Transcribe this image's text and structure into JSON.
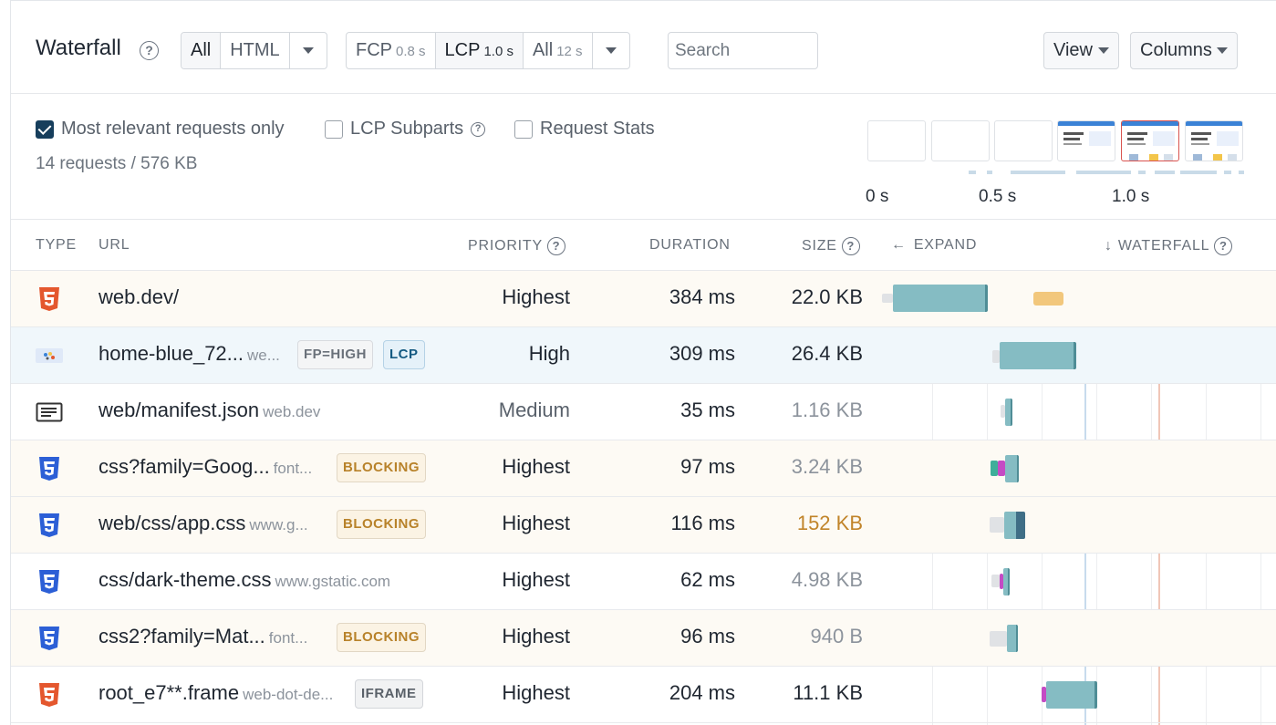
{
  "header": {
    "title": "Waterfall",
    "help_icon": "question-circle-icon",
    "filter_type": [
      {
        "label": "All",
        "active": true
      },
      {
        "label": "HTML",
        "active": false
      }
    ],
    "filter_time": [
      {
        "label": "FCP",
        "sub": "0.8 s",
        "active": false
      },
      {
        "label": "LCP",
        "sub": "1.0 s",
        "active": true
      },
      {
        "label": "All",
        "sub": "12 s",
        "active": false
      }
    ],
    "search_placeholder": "Search",
    "view_label": "View",
    "columns_label": "Columns"
  },
  "options": {
    "most_relevant": {
      "label": "Most relevant requests only",
      "checked": true
    },
    "lcp_subparts": {
      "label": "LCP Subparts",
      "checked": false
    },
    "request_stats": {
      "label": "Request Stats",
      "checked": false
    },
    "summary": "14 requests / 576 KB",
    "timeline_labels": [
      "0 s",
      "0.5 s",
      "1.0 s"
    ]
  },
  "columns": {
    "type": "TYPE",
    "url": "URL",
    "priority": "PRIORITY",
    "duration": "DURATION",
    "size": "SIZE",
    "expand": "EXPAND",
    "waterfall": "WATERFALL"
  },
  "rows": [
    {
      "type": "html",
      "url": "web.dev/",
      "host": "",
      "tags": [],
      "priority": "Highest",
      "duration": "384 ms",
      "size": "22.0 KB",
      "size_style": "normal"
    },
    {
      "type": "image",
      "url": "home-blue_72...",
      "host": "we...",
      "tags": [
        "FP=HIGH",
        "LCP"
      ],
      "priority": "High",
      "duration": "309 ms",
      "size": "26.4 KB",
      "size_style": "normal"
    },
    {
      "type": "json",
      "url": "web/manifest.json",
      "host": "web.dev",
      "tags": [],
      "priority": "Medium",
      "duration": "35 ms",
      "size": "1.16 KB",
      "size_style": "muted"
    },
    {
      "type": "css",
      "url": "css?family=Goog...",
      "host": "font...",
      "tags": [
        "BLOCKING"
      ],
      "priority": "Highest",
      "duration": "97 ms",
      "size": "3.24 KB",
      "size_style": "muted"
    },
    {
      "type": "css",
      "url": "web/css/app.css",
      "host": "www.g...",
      "tags": [
        "BLOCKING"
      ],
      "priority": "Highest",
      "duration": "116 ms",
      "size": "152 KB",
      "size_style": "warn"
    },
    {
      "type": "css",
      "url": "css/dark-theme.css",
      "host": "www.gstatic.com",
      "tags": [],
      "priority": "Highest",
      "duration": "62 ms",
      "size": "4.98 KB",
      "size_style": "muted"
    },
    {
      "type": "css",
      "url": "css2?family=Mat...",
      "host": "font...",
      "tags": [
        "BLOCKING"
      ],
      "priority": "Highest",
      "duration": "96 ms",
      "size": "940 B",
      "size_style": "muted"
    },
    {
      "type": "html",
      "url": "root_e7**.frame",
      "host": "web-dot-de...",
      "tags": [
        "IFRAME"
      ],
      "priority": "Highest",
      "duration": "204 ms",
      "size": "11.1 KB",
      "size_style": "normal"
    }
  ],
  "colors": {
    "download": "#85bcc3",
    "html_icon": "#e4572e",
    "css_icon": "#2c5fd6",
    "checkbox_checked": "#163e5c",
    "blocking": "#b8822a"
  }
}
